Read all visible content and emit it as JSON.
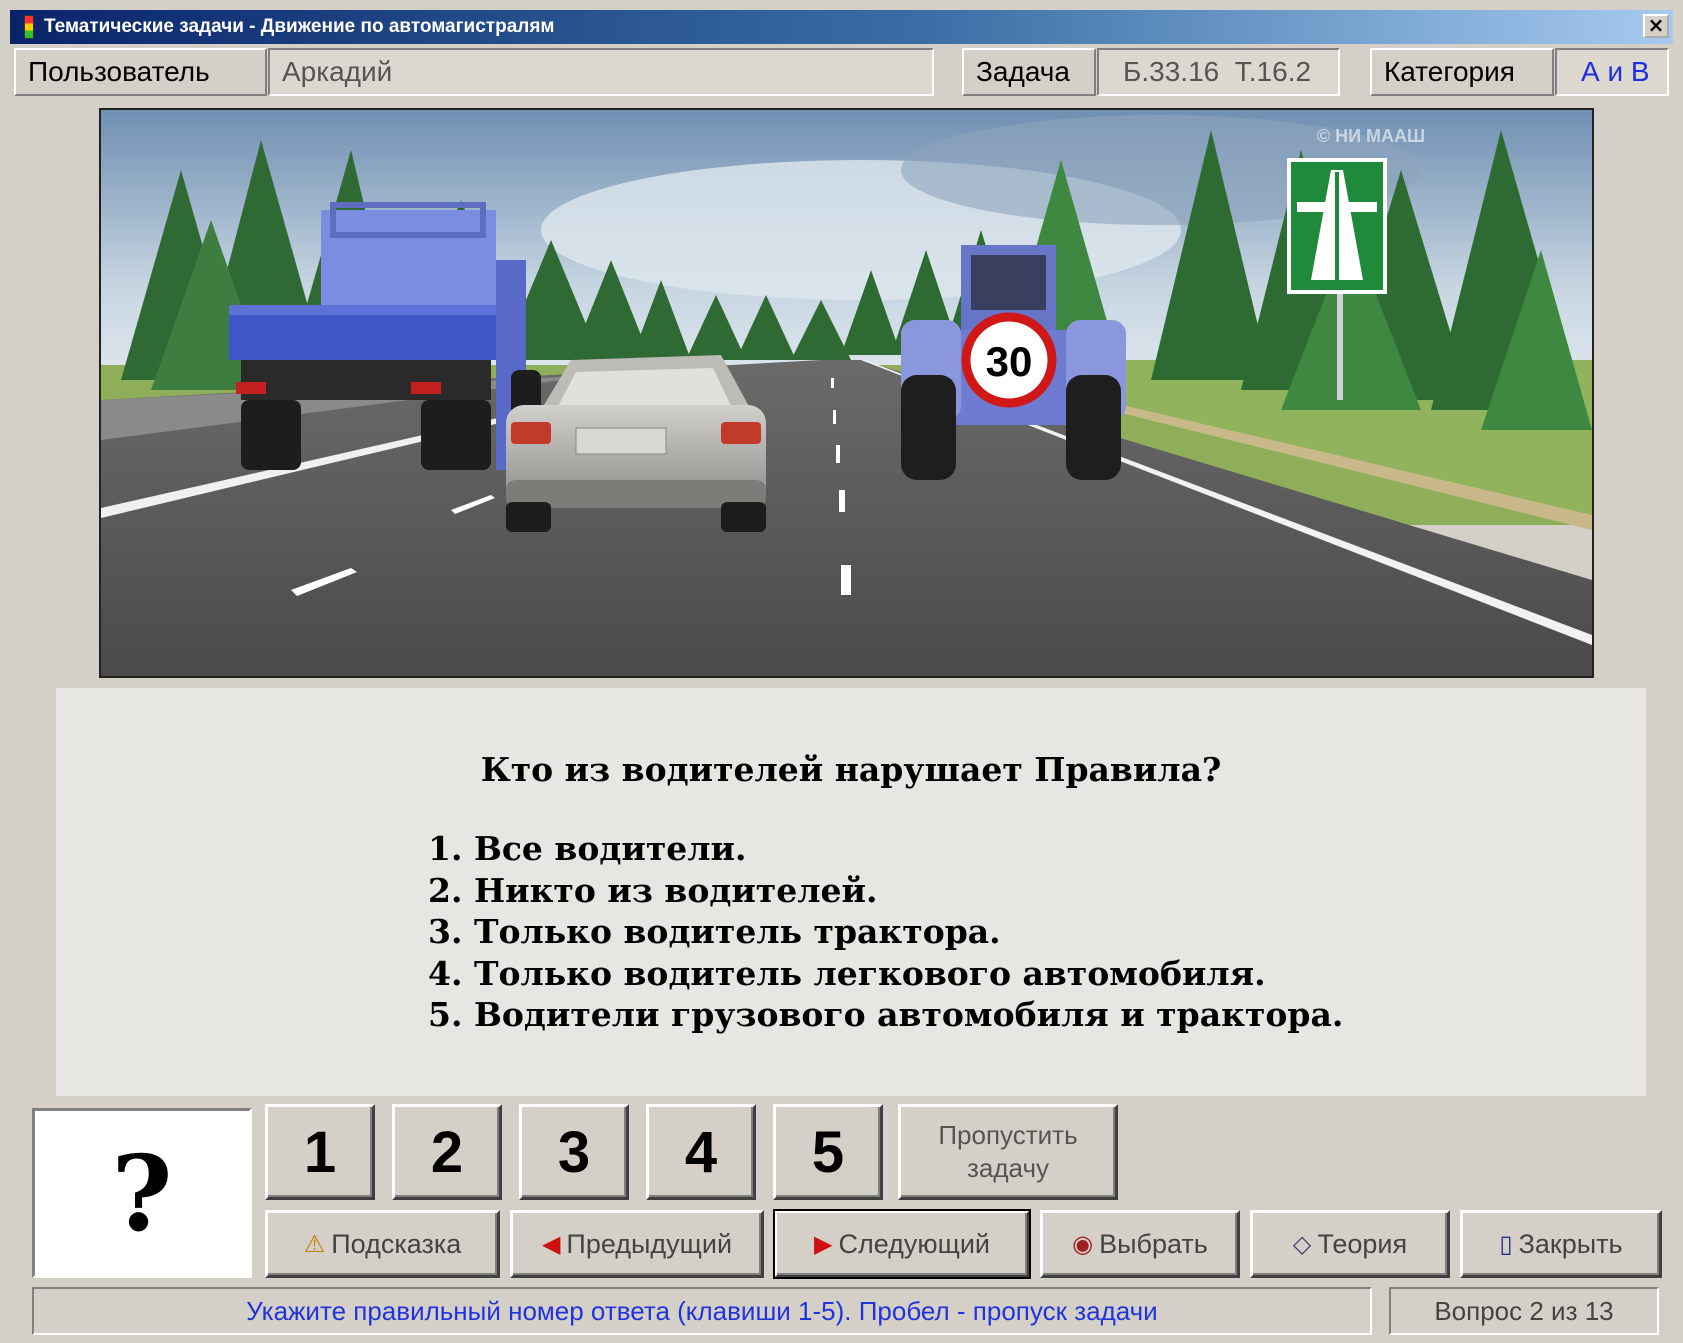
{
  "window": {
    "title": "Тематические задачи - Движение по автомагистралям",
    "close_glyph": "×"
  },
  "infobar": {
    "user_label": "Пользователь",
    "user_value": "Аркадий",
    "task_label": "Задача",
    "task_value": "Б.33.16  Т.16.2",
    "category_label": "Категория",
    "category_value": "А и В"
  },
  "scene": {
    "speed_sign": "30",
    "watermark": "© НИ МААШ"
  },
  "question": {
    "text": "Кто из водителей нарушает Правила?",
    "answers": [
      "1. Все водители.",
      "2. Никто из водителей.",
      "3. Только водитель трактора.",
      "4. Только водитель легкового автомобиля.",
      "5. Водители грузового автомобиля и трактора."
    ]
  },
  "controls": {
    "answer_indicator": "?",
    "answer_buttons": [
      "1",
      "2",
      "3",
      "4",
      "5"
    ],
    "skip": "Пропустить\nзадачу",
    "hint": "Подсказка",
    "prev": "Предыдущий",
    "next": "Следующий",
    "select": "Выбрать",
    "theory": "Теория",
    "close": "Закрыть"
  },
  "status": {
    "hint": "Укажите правильный номер ответа (клавиши 1-5). Пробел - пропуск задачи",
    "progress": "Вопрос 2 из 13"
  },
  "colors": {
    "accent_blue": "#1e2ee0",
    "status_text": "#2233dd",
    "arrow_red": "#d01010"
  }
}
